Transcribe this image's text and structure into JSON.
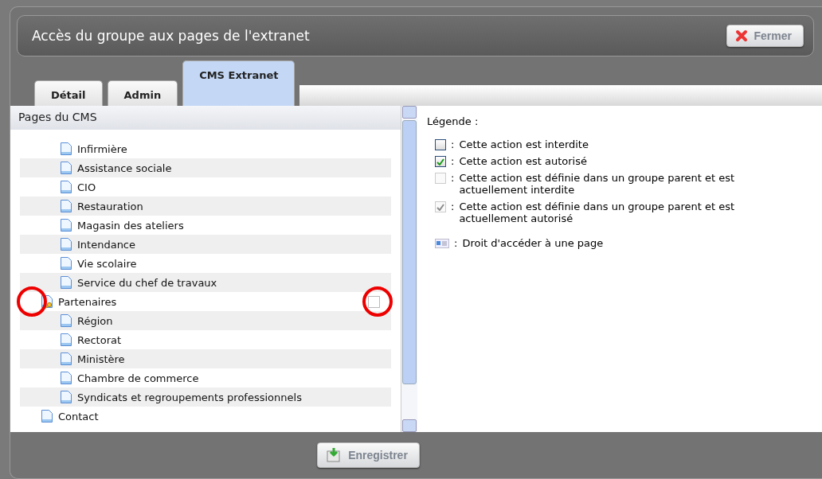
{
  "window": {
    "title": "Accès du groupe aux pages de l'extranet",
    "close_button": "Fermer"
  },
  "tabs": [
    {
      "label": "Détail",
      "selected": false
    },
    {
      "label": "Admin",
      "selected": false
    },
    {
      "label": "CMS Extranet",
      "selected": true
    }
  ],
  "pages_panel": {
    "title": "Pages du CMS",
    "tree": [
      {
        "children": [
          {
            "label": "Infirmière"
          },
          {
            "label": "Assistance sociale"
          },
          {
            "label": "CIO"
          },
          {
            "label": "Restauration"
          },
          {
            "label": "Magasin des ateliers"
          },
          {
            "label": "Intendance"
          },
          {
            "label": "Vie scolaire"
          },
          {
            "label": "Service du chef de travaux"
          }
        ]
      },
      {
        "label": "Partenaires",
        "kind": "restricted",
        "checked": false,
        "annotated": true,
        "children": [
          {
            "label": "Région"
          },
          {
            "label": "Rectorat"
          },
          {
            "label": "Ministère"
          },
          {
            "label": "Chambre de commerce"
          },
          {
            "label": "Syndicats et regroupements professionnels"
          }
        ]
      },
      {
        "label": "Contact"
      }
    ]
  },
  "legend": {
    "title": "Légende :",
    "separator": ":",
    "items": [
      {
        "kind": "checkbox",
        "checked": false,
        "inherited": false,
        "text": "Cette action est interdite"
      },
      {
        "kind": "checkbox",
        "checked": true,
        "inherited": false,
        "text": "Cette action est autorisé"
      },
      {
        "kind": "checkbox",
        "checked": false,
        "inherited": true,
        "text": "Cette action est définie dans un groupe parent et est actuellement interdite"
      },
      {
        "kind": "checkbox",
        "checked": true,
        "inherited": true,
        "text": "Cette action est définie dans un groupe parent et est actuellement autorisé"
      },
      {
        "kind": "page-access",
        "text": "Droit d'accéder à une page"
      }
    ]
  },
  "footer": {
    "save_button": "Enregistrer"
  }
}
